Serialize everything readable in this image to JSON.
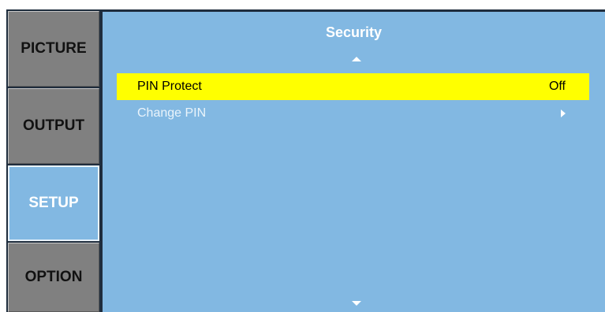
{
  "tabs": {
    "picture": "PICTURE",
    "output": "OUTPUT",
    "setup": "SETUP",
    "option": "OPTION",
    "active": "SETUP"
  },
  "panel": {
    "title": "Security",
    "scroll_up_icon": "triangle-up-icon",
    "scroll_down_icon": "triangle-down-icon",
    "items": [
      {
        "label": "PIN Protect",
        "value": "Off",
        "selected": true
      },
      {
        "label": "Change PIN",
        "icon": "chevron-right-icon",
        "selected": false
      }
    ]
  },
  "colors": {
    "panel_bg": "#82b8e2",
    "tab_bg": "#808080",
    "highlight": "#ffff00",
    "frame": "#1f2d3d"
  }
}
